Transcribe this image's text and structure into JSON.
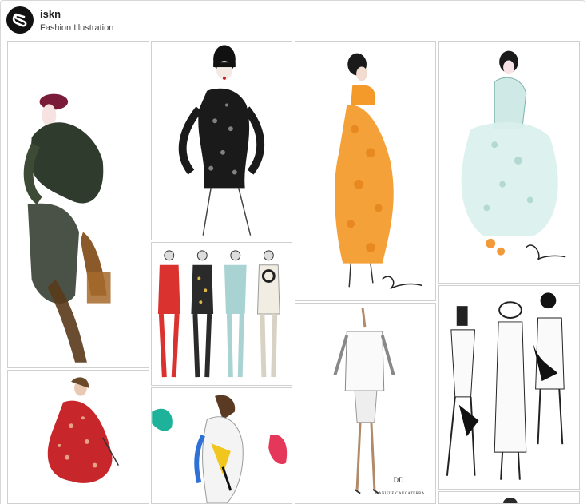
{
  "profile": {
    "name": "iskn",
    "board": "Fashion Illustration",
    "avatar_icon": "iskn-logo-icon"
  },
  "pins": [
    {
      "id": "watercolor-green-dress",
      "alt": ""
    },
    {
      "id": "lace-bodysuit-masked",
      "alt": ""
    },
    {
      "id": "orange-gown-watercolor",
      "alt": ""
    },
    {
      "id": "mint-tulle-gown",
      "alt": ""
    },
    {
      "id": "four-looks-lineup",
      "alt": ""
    },
    {
      "id": "white-tunic-sketch",
      "alt": "",
      "signature": "DANIELE CAUCATERRA"
    },
    {
      "id": "black-white-trio",
      "alt": ""
    },
    {
      "id": "red-floral-coat",
      "alt": ""
    },
    {
      "id": "colorful-watercolor-figure",
      "alt": ""
    },
    {
      "id": "partial-figure-bottom",
      "alt": ""
    }
  ]
}
